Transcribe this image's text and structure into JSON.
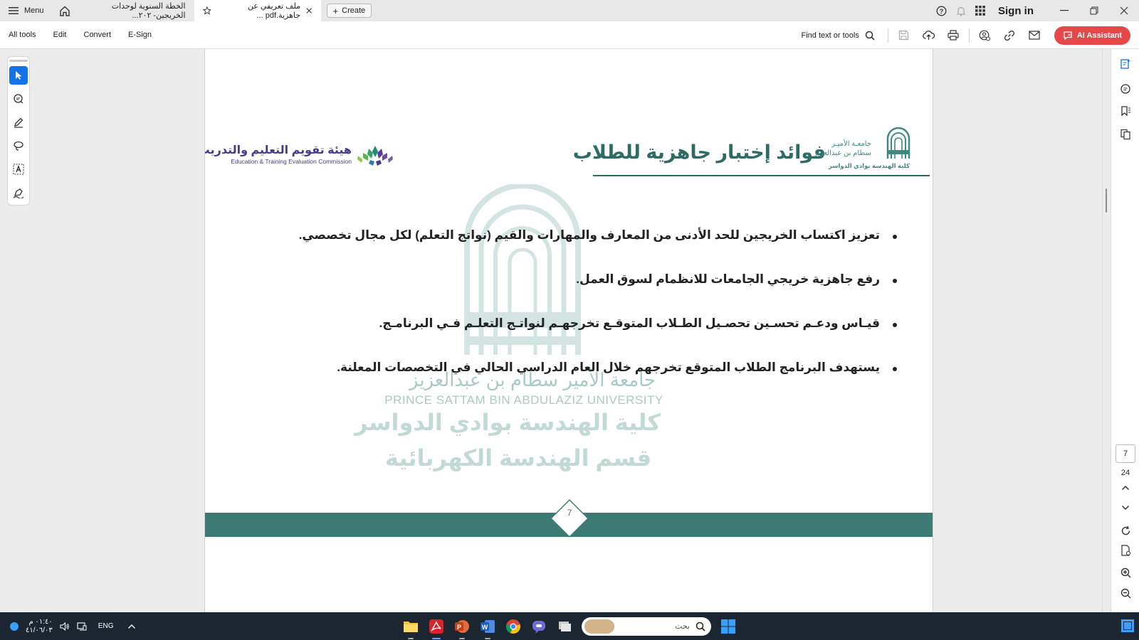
{
  "titlebar": {
    "menu_label": "Menu",
    "tabs": [
      {
        "label": "الخطة السنوية لوحدات الخريجين- ٢٠٢..."
      },
      {
        "label": "ملف تعريفي عن جاهزية.pdf ..."
      }
    ],
    "create_label": "Create",
    "signin_label": "Sign in"
  },
  "toolbar": {
    "menu": [
      "All tools",
      "Edit",
      "Convert",
      "E-Sign"
    ],
    "find_label": "Find text or tools",
    "ai_label": "AI Assistant"
  },
  "slide": {
    "etec_ar": "هيئة تقويم التعليم والتدريب",
    "etec_en": "Education & Training Evaluation Commission",
    "title": "فوائد إختبار جاهزية للطلاب",
    "uni_ar1": "جامعـة الأميـر",
    "uni_ar2": "سطام بن عبدالعزيز",
    "uni_ar3": "كلية الهندسة بوادي الدواسر",
    "watermark": {
      "uni_ar": "جامعة الأمير سطام بن عبدالعزيز",
      "uni_en": "PRINCE SATTAM BIN ABDULAZIZ UNIVERSITY",
      "college": "كلية الهندسة بوادي الدواسر",
      "dept": "قسم الهندسة الكهربائية"
    },
    "bullets": [
      "تعزيز اكتساب الخريجين للحد الأدنى من المعارف والمهارات والقيم (نواتج التعلم) لكل مجال تخصصي.",
      "رفع جاهزية خريجي الجامعات للانظمام لسوق العمل.",
      "قيـاس ودعـم تحسـين تحصـيل الطـلاب المتوقـع تخرجهـم لنواتـج التعلـم فـي البرنامـج.",
      "يستهدف البرنامج الطلاب المتوقع تخرجهم خلال العام الدراسي الحالي في التخصصات المعلنة."
    ],
    "page_number": "7"
  },
  "navigator": {
    "current_page": "7",
    "total_pages": "24"
  },
  "taskbar": {
    "time": "٠١:٤٠ م",
    "date": "٤١/٠٦/٠٣",
    "lang": "ENG",
    "search_placeholder": "بحث"
  },
  "colors": {
    "accent_teal": "#3d7a73",
    "title_teal": "#2e6b64",
    "etec_purple": "#4a3a8c",
    "ai_red": "#e54848",
    "select_blue": "#1473e6"
  }
}
